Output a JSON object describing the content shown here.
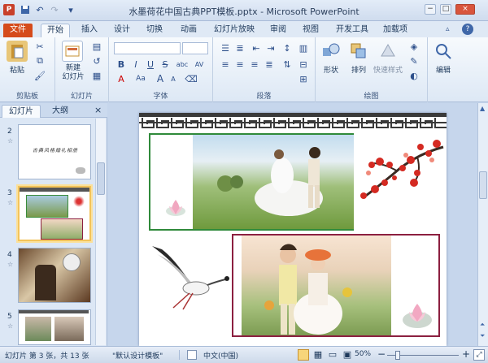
{
  "window": {
    "title": "水墨荷花中国古典PPT模板.pptx - Microsoft PowerPoint"
  },
  "quick_access": [
    {
      "name": "app-logo-icon",
      "glyph": "P"
    },
    {
      "name": "save-icon",
      "glyph": "💾"
    },
    {
      "name": "undo-icon",
      "glyph": "↶"
    },
    {
      "name": "redo-icon",
      "glyph": "↷"
    },
    {
      "name": "customize-qat-icon",
      "glyph": "▾"
    }
  ],
  "tabs": [
    "文件",
    "开始",
    "插入",
    "设计",
    "切换",
    "动画",
    "幻灯片放映",
    "审阅",
    "视图",
    "开发工具",
    "加载项"
  ],
  "ribbon": {
    "clipboard": {
      "label": "剪贴板",
      "paste": "粘贴"
    },
    "slides": {
      "label": "幻灯片",
      "new_slide": "新建\n幻灯片"
    },
    "font": {
      "label": "字体",
      "bold": "B",
      "italic": "I",
      "underline": "U",
      "strike": "S",
      "shadow": "abc",
      "spacing": "AV",
      "case": "Aa",
      "color": "A",
      "grow": "A",
      "shrink": "A"
    },
    "paragraph": {
      "label": "段落"
    },
    "drawing": {
      "label": "绘图",
      "shapes": "形状",
      "arrange": "排列",
      "quick_styles": "快速样式"
    },
    "editing": {
      "label": "编辑"
    }
  },
  "pane": {
    "tab_slides": "幻灯片",
    "tab_outline": "大纲",
    "close": "×",
    "thumbs": [
      {
        "num": "2",
        "text": "古典风格婚礼相册"
      },
      {
        "num": "3"
      },
      {
        "num": "4"
      },
      {
        "num": "5"
      }
    ]
  },
  "status": {
    "slide_info": "幻灯片 第 3 张，共 13 张",
    "theme": "\"默认设计模板\"",
    "language": "中文(中国)",
    "zoom": "50%",
    "zoom_out": "−",
    "zoom_in": "+"
  },
  "colors": {
    "file_tab": "#d54b1b",
    "accent": "#2d4f8a",
    "selection": "#f3c35a"
  }
}
